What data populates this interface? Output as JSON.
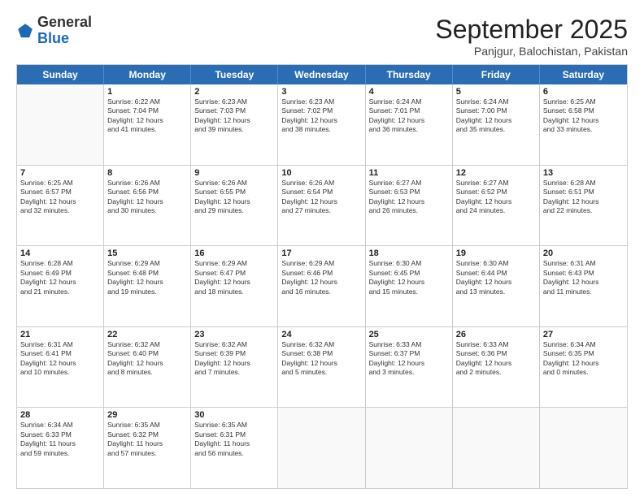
{
  "header": {
    "logo_general": "General",
    "logo_blue": "Blue",
    "month_title": "September 2025",
    "subtitle": "Panjgur, Balochistan, Pakistan"
  },
  "days_of_week": [
    "Sunday",
    "Monday",
    "Tuesday",
    "Wednesday",
    "Thursday",
    "Friday",
    "Saturday"
  ],
  "rows": [
    [
      {
        "day": "",
        "lines": []
      },
      {
        "day": "1",
        "lines": [
          "Sunrise: 6:22 AM",
          "Sunset: 7:04 PM",
          "Daylight: 12 hours",
          "and 41 minutes."
        ]
      },
      {
        "day": "2",
        "lines": [
          "Sunrise: 6:23 AM",
          "Sunset: 7:03 PM",
          "Daylight: 12 hours",
          "and 39 minutes."
        ]
      },
      {
        "day": "3",
        "lines": [
          "Sunrise: 6:23 AM",
          "Sunset: 7:02 PM",
          "Daylight: 12 hours",
          "and 38 minutes."
        ]
      },
      {
        "day": "4",
        "lines": [
          "Sunrise: 6:24 AM",
          "Sunset: 7:01 PM",
          "Daylight: 12 hours",
          "and 36 minutes."
        ]
      },
      {
        "day": "5",
        "lines": [
          "Sunrise: 6:24 AM",
          "Sunset: 7:00 PM",
          "Daylight: 12 hours",
          "and 35 minutes."
        ]
      },
      {
        "day": "6",
        "lines": [
          "Sunrise: 6:25 AM",
          "Sunset: 6:58 PM",
          "Daylight: 12 hours",
          "and 33 minutes."
        ]
      }
    ],
    [
      {
        "day": "7",
        "lines": [
          "Sunrise: 6:25 AM",
          "Sunset: 6:57 PM",
          "Daylight: 12 hours",
          "and 32 minutes."
        ]
      },
      {
        "day": "8",
        "lines": [
          "Sunrise: 6:26 AM",
          "Sunset: 6:56 PM",
          "Daylight: 12 hours",
          "and 30 minutes."
        ]
      },
      {
        "day": "9",
        "lines": [
          "Sunrise: 6:26 AM",
          "Sunset: 6:55 PM",
          "Daylight: 12 hours",
          "and 29 minutes."
        ]
      },
      {
        "day": "10",
        "lines": [
          "Sunrise: 6:26 AM",
          "Sunset: 6:54 PM",
          "Daylight: 12 hours",
          "and 27 minutes."
        ]
      },
      {
        "day": "11",
        "lines": [
          "Sunrise: 6:27 AM",
          "Sunset: 6:53 PM",
          "Daylight: 12 hours",
          "and 26 minutes."
        ]
      },
      {
        "day": "12",
        "lines": [
          "Sunrise: 6:27 AM",
          "Sunset: 6:52 PM",
          "Daylight: 12 hours",
          "and 24 minutes."
        ]
      },
      {
        "day": "13",
        "lines": [
          "Sunrise: 6:28 AM",
          "Sunset: 6:51 PM",
          "Daylight: 12 hours",
          "and 22 minutes."
        ]
      }
    ],
    [
      {
        "day": "14",
        "lines": [
          "Sunrise: 6:28 AM",
          "Sunset: 6:49 PM",
          "Daylight: 12 hours",
          "and 21 minutes."
        ]
      },
      {
        "day": "15",
        "lines": [
          "Sunrise: 6:29 AM",
          "Sunset: 6:48 PM",
          "Daylight: 12 hours",
          "and 19 minutes."
        ]
      },
      {
        "day": "16",
        "lines": [
          "Sunrise: 6:29 AM",
          "Sunset: 6:47 PM",
          "Daylight: 12 hours",
          "and 18 minutes."
        ]
      },
      {
        "day": "17",
        "lines": [
          "Sunrise: 6:29 AM",
          "Sunset: 6:46 PM",
          "Daylight: 12 hours",
          "and 16 minutes."
        ]
      },
      {
        "day": "18",
        "lines": [
          "Sunrise: 6:30 AM",
          "Sunset: 6:45 PM",
          "Daylight: 12 hours",
          "and 15 minutes."
        ]
      },
      {
        "day": "19",
        "lines": [
          "Sunrise: 6:30 AM",
          "Sunset: 6:44 PM",
          "Daylight: 12 hours",
          "and 13 minutes."
        ]
      },
      {
        "day": "20",
        "lines": [
          "Sunrise: 6:31 AM",
          "Sunset: 6:43 PM",
          "Daylight: 12 hours",
          "and 11 minutes."
        ]
      }
    ],
    [
      {
        "day": "21",
        "lines": [
          "Sunrise: 6:31 AM",
          "Sunset: 6:41 PM",
          "Daylight: 12 hours",
          "and 10 minutes."
        ]
      },
      {
        "day": "22",
        "lines": [
          "Sunrise: 6:32 AM",
          "Sunset: 6:40 PM",
          "Daylight: 12 hours",
          "and 8 minutes."
        ]
      },
      {
        "day": "23",
        "lines": [
          "Sunrise: 6:32 AM",
          "Sunset: 6:39 PM",
          "Daylight: 12 hours",
          "and 7 minutes."
        ]
      },
      {
        "day": "24",
        "lines": [
          "Sunrise: 6:32 AM",
          "Sunset: 6:38 PM",
          "Daylight: 12 hours",
          "and 5 minutes."
        ]
      },
      {
        "day": "25",
        "lines": [
          "Sunrise: 6:33 AM",
          "Sunset: 6:37 PM",
          "Daylight: 12 hours",
          "and 3 minutes."
        ]
      },
      {
        "day": "26",
        "lines": [
          "Sunrise: 6:33 AM",
          "Sunset: 6:36 PM",
          "Daylight: 12 hours",
          "and 2 minutes."
        ]
      },
      {
        "day": "27",
        "lines": [
          "Sunrise: 6:34 AM",
          "Sunset: 6:35 PM",
          "Daylight: 12 hours",
          "and 0 minutes."
        ]
      }
    ],
    [
      {
        "day": "28",
        "lines": [
          "Sunrise: 6:34 AM",
          "Sunset: 6:33 PM",
          "Daylight: 11 hours",
          "and 59 minutes."
        ]
      },
      {
        "day": "29",
        "lines": [
          "Sunrise: 6:35 AM",
          "Sunset: 6:32 PM",
          "Daylight: 11 hours",
          "and 57 minutes."
        ]
      },
      {
        "day": "30",
        "lines": [
          "Sunrise: 6:35 AM",
          "Sunset: 6:31 PM",
          "Daylight: 11 hours",
          "and 56 minutes."
        ]
      },
      {
        "day": "",
        "lines": []
      },
      {
        "day": "",
        "lines": []
      },
      {
        "day": "",
        "lines": []
      },
      {
        "day": "",
        "lines": []
      }
    ]
  ]
}
